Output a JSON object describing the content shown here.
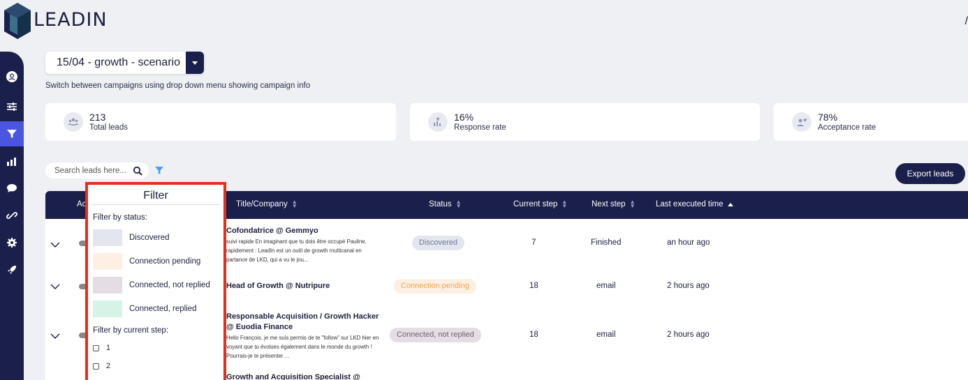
{
  "app": {
    "logo_text": "LEADIN",
    "colors": {
      "navy": "#1b1f4b",
      "accent": "#4a56e2",
      "highlight": "#e62e1b"
    }
  },
  "sidebar": {
    "items": [
      {
        "icon": "user-icon",
        "active": false
      },
      {
        "icon": "sliders-icon",
        "active": false
      },
      {
        "icon": "funnel-icon",
        "active": true
      },
      {
        "icon": "bar-chart-icon",
        "active": false
      },
      {
        "icon": "chat-icon",
        "active": false
      },
      {
        "icon": "link-icon",
        "active": false
      },
      {
        "icon": "gear-icon",
        "active": false
      },
      {
        "icon": "rocket-icon",
        "active": false
      }
    ]
  },
  "campaign": {
    "selected": "15/04 - growth - scenario",
    "hint": "Switch between campaigns using drop down menu showing campaign info"
  },
  "stats": [
    {
      "value": "213",
      "label": "Total leads",
      "icon": "users-icon"
    },
    {
      "value": "16%",
      "label": "Response rate",
      "icon": "response-chart-icon"
    },
    {
      "value": "78%",
      "label": "Acceptance rate",
      "icon": "acceptance-icon"
    }
  ],
  "search": {
    "placeholder": "Search leads here..."
  },
  "export_label": "Export leads",
  "table": {
    "headers": {
      "actions": "Ac",
      "title": "Title/Company",
      "status": "Status",
      "current_step": "Current step",
      "next_step": "Next step",
      "last_executed": "Last executed time"
    },
    "rows": [
      {
        "title": "Cofondatrice @ Gemmyo",
        "snippet": "suivi rapide En imaginant que tu dois être occupé Pauline, rapidement : LeadIn est un outil de growth multicanal en partance de LKD, qui a vu le jou...",
        "status": "Discovered",
        "current_step": "7",
        "next_step": "Finished",
        "last_executed": "an hour ago"
      },
      {
        "title": "Head of Growth @ Nutripure",
        "snippet": "",
        "status": "Connection pending",
        "current_step": "18",
        "next_step": "email",
        "last_executed": "2 hours ago"
      },
      {
        "title": "Responsable Acquisition / Growth Hacker @ Euodia Finance",
        "snippet": "Hello François, je me suis permis de te \"follow\" sur LKD hier en voyant que tu évolues également dans le monde du growth ! Pourrais-je te présenter ...",
        "status": "Connected, not replied",
        "current_step": "18",
        "next_step": "email",
        "last_executed": "2 hours ago"
      },
      {
        "title": "Growth and Acquisition Specialist @",
        "snippet": "",
        "status": "",
        "current_step": "",
        "next_step": "",
        "last_executed": ""
      }
    ]
  },
  "filter": {
    "title": "Filter",
    "status_heading": "Filter by status:",
    "status_options": [
      {
        "label": "Discovered",
        "color": "#e3e6ef"
      },
      {
        "label": "Connection pending",
        "color": "#fdf0e3"
      },
      {
        "label": "Connected, not replied",
        "color": "#e4dde4"
      },
      {
        "label": "Connected, replied",
        "color": "#d6f4e6"
      }
    ],
    "step_heading": "Filter by current step:",
    "step_options": [
      "1",
      "2"
    ]
  }
}
